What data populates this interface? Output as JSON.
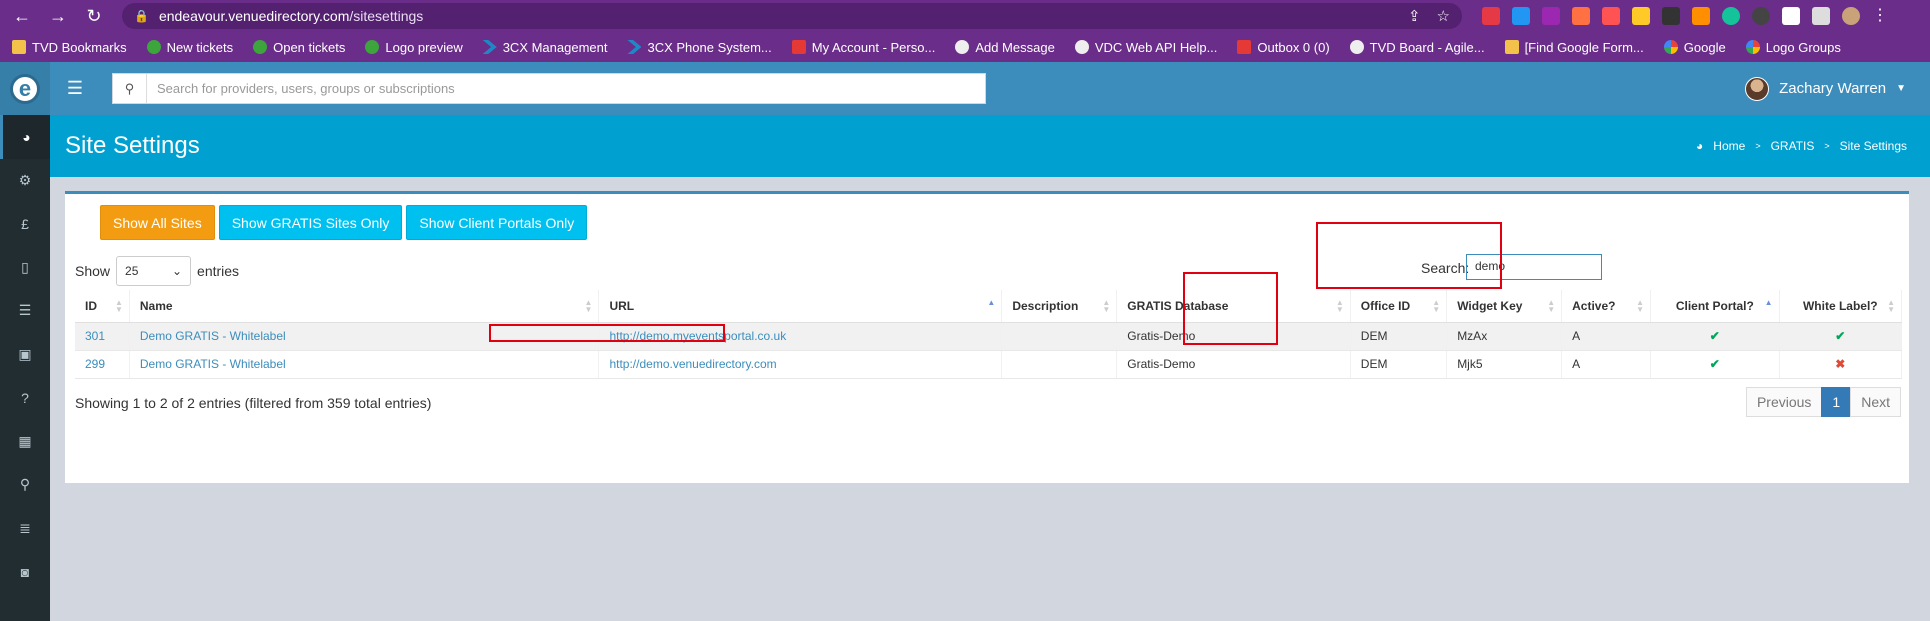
{
  "browser": {
    "url_host": "endeavour.venuedirectory.com",
    "url_path": "/sitesettings",
    "bookmarks": [
      {
        "label": "TVD Bookmarks",
        "icon": "folder-icon"
      },
      {
        "label": "New tickets",
        "icon": "green-circle-icon"
      },
      {
        "label": "Open tickets",
        "icon": "green-circle-icon"
      },
      {
        "label": "Logo preview",
        "icon": "green-circle-icon"
      },
      {
        "label": "3CX Management",
        "icon": "chevron-icon"
      },
      {
        "label": "3CX Phone System...",
        "icon": "chevron-icon"
      },
      {
        "label": "My Account - Perso...",
        "icon": "flame-icon"
      },
      {
        "label": "Add Message",
        "icon": "circle-c-icon"
      },
      {
        "label": "VDC Web API Help...",
        "icon": "globe-icon"
      },
      {
        "label": "Outbox 0 (0)",
        "icon": "red-square-icon"
      },
      {
        "label": "TVD Board - Agile...",
        "icon": "board-icon"
      },
      {
        "label": "[Find Google Form...",
        "icon": "form-icon"
      },
      {
        "label": "Google",
        "icon": "google-icon"
      },
      {
        "label": "Logo Groups",
        "icon": "google-icon"
      }
    ]
  },
  "header": {
    "logo": "e",
    "search_placeholder": "Search for providers, users, groups or subscriptions",
    "user_name": "Zachary Warren"
  },
  "sidebar": [
    "dashboard-icon",
    "cogs-icon",
    "pound-icon",
    "file-icon",
    "list-icon",
    "image-icon",
    "question-icon",
    "calendar-icon",
    "map-marker-icon",
    "database-icon",
    "money-icon"
  ],
  "page": {
    "title": "Site Settings",
    "breadcrumb": [
      "Home",
      "GRATIS",
      "Site Settings"
    ]
  },
  "filters": {
    "all": "Show All Sites",
    "gratis": "Show GRATIS Sites Only",
    "portals": "Show Client Portals Only"
  },
  "table_controls": {
    "show": "Show",
    "entries_value": "25",
    "entries": "entries",
    "search_label": "Search:",
    "search_value": "demo"
  },
  "table": {
    "columns": [
      "ID",
      "Name",
      "URL",
      "Description",
      "GRATIS Database",
      "Office ID",
      "Widget Key",
      "Active?",
      "Client Portal?",
      "White Label?"
    ],
    "rows": [
      {
        "id": "301",
        "name": "Demo GRATIS - Whitelabel",
        "url": "http://demo.myeventsportal.co.uk",
        "description": "",
        "db": "Gratis-Demo",
        "office": "DEM",
        "widget": "MzAx",
        "active": "A",
        "portal": "✔",
        "white": "✔"
      },
      {
        "id": "299",
        "name": "Demo GRATIS - Whitelabel",
        "url": "http://demo.venuedirectory.com",
        "description": "",
        "db": "Gratis-Demo",
        "office": "DEM",
        "widget": "Mjk5",
        "active": "A",
        "portal": "✔",
        "white": "✖"
      }
    ]
  },
  "footer": {
    "info": "Showing 1 to 2 of 2 entries (filtered from 359 total entries)",
    "previous": "Previous",
    "page": "1",
    "next": "Next"
  }
}
